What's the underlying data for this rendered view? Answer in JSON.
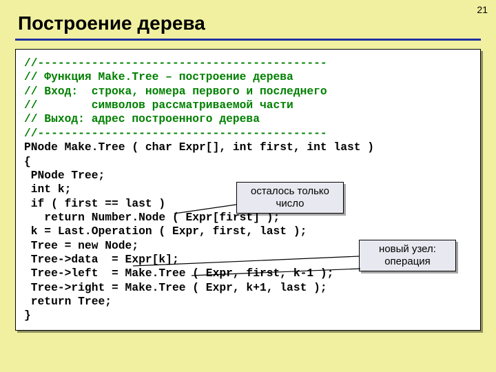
{
  "slide_number": "21",
  "title": "Построение дерева",
  "code": {
    "c1": "//-------------------------------------------",
    "c2": "// Функция Make.Tree – построение дерева",
    "c3": "// Вход:  строка, номера первого и последнего",
    "c4": "//        символов рассматриваемой части",
    "c5": "// Выход: адрес построенного дерева",
    "c6": "//-------------------------------------------",
    "l1": "PNode Make.Tree ( char Expr[], int first, int last )",
    "l2": "{",
    "l3": " PNode Tree;",
    "l4": " int k;",
    "l5": " if ( first == last )",
    "l6": "   return Number.Node ( Expr[first] );",
    "l7": " k = Last.Operation ( Expr, first, last );",
    "l8": " Tree = new Node;",
    "l9": " Tree->data  = Expr[k];",
    "l10": " Tree->left  = Make.Tree ( Expr, first, k-1 );",
    "l11": " Tree->right = Make.Tree ( Expr, k+1, last );",
    "l12": " return Tree;",
    "l13": "}"
  },
  "callouts": {
    "c1": "осталось только число",
    "c2": "новый узел: операция"
  }
}
